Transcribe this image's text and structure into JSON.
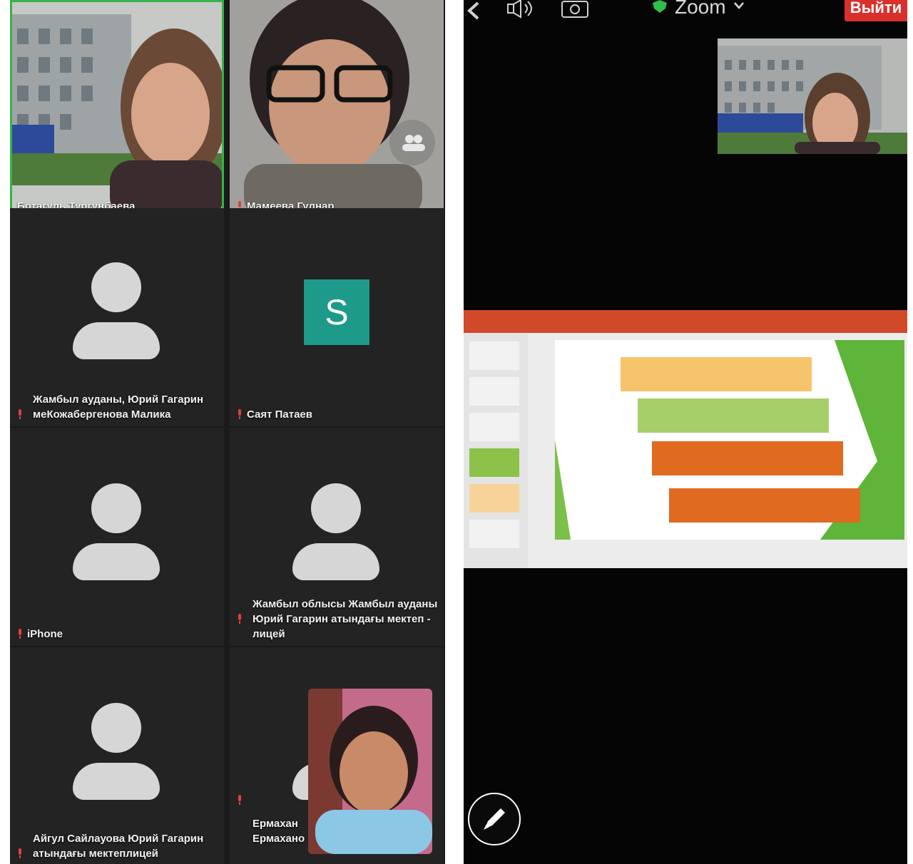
{
  "gallery": {
    "tiles": [
      {
        "name": "Ботагуль Тургунбаева",
        "kind": "video"
      },
      {
        "name": "Мамеева Гулнар",
        "kind": "video"
      },
      {
        "name": "Жамбыл ауданы, Юрий Гагарин меКожабергенова Малика",
        "kind": "avatar"
      },
      {
        "name": "Саят Патаев",
        "kind": "initial",
        "initial": "S"
      },
      {
        "name": "iPhone",
        "kind": "avatar"
      },
      {
        "name": "Жамбыл облысы Жамбыл ауданы Юрий Гагарин атындағы мектеп - лицей",
        "kind": "avatar"
      },
      {
        "name": "Айгул Сайлауова Юрий Гагарин атындағы мектеплицей",
        "kind": "avatar"
      },
      {
        "name": "Ермахан\nЕрмахано",
        "kind": "avatar-with-overlay"
      }
    ]
  },
  "meeting": {
    "app_label": "Zoom",
    "leave_label": "Выйти"
  },
  "colors": {
    "active_speaker_border": "#38b24a",
    "leave_button": "#d9302c",
    "ppt_ribbon": "#d04a2a",
    "initial_tile": "#1e9a8a",
    "shield": "#2fbf4a"
  },
  "icons": [
    "back-arrow-icon",
    "speaker-icon",
    "camera-switch-icon",
    "shield-icon",
    "chevron-down-icon",
    "mic-muted-icon",
    "participants-icon",
    "pencil-icon"
  ]
}
